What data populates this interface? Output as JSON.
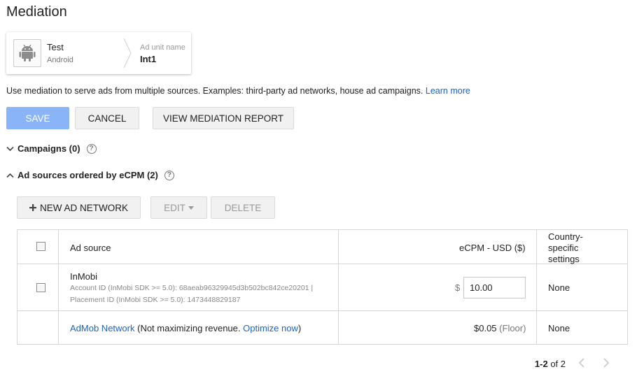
{
  "page": {
    "title": "Mediation"
  },
  "app_card": {
    "app_name": "Test",
    "platform": "Android",
    "ad_unit_label": "Ad unit name",
    "ad_unit_name": "Int1"
  },
  "description": {
    "text": "Use mediation to serve ads from multiple sources. Examples: third-party ad networks, house ad campaigns.",
    "learn_more": "Learn more"
  },
  "toolbar": {
    "save_label": "SAVE",
    "cancel_label": "CANCEL",
    "report_label": "VIEW MEDIATION REPORT"
  },
  "sections": {
    "campaigns": "Campaigns (0)",
    "ad_sources": "Ad sources ordered by eCPM (2)"
  },
  "table_toolbar": {
    "new_label": "NEW AD NETWORK",
    "edit_label": "EDIT",
    "delete_label": "DELETE"
  },
  "table": {
    "headers": {
      "ad_source": "Ad source",
      "ecpm": "eCPM - USD ($)",
      "country_line1": "Country-",
      "country_line2": "specific",
      "country_line3": "settings"
    },
    "rows": [
      {
        "name": "InMobi",
        "detail1": "Account ID (InMobi SDK >= 5.0): 68aeab96329945d3b502bc842ce20201 |",
        "detail2": "Placement ID (InMobi SDK >= 5.0): 1473448829187",
        "currency": "$",
        "ecpm_value": "10.00",
        "country": "None"
      },
      {
        "name": "AdMob Network",
        "note_prefix": "(Not maximizing revenue.",
        "optimize": "Optimize now",
        "note_suffix": ")",
        "ecpm_value": "$0.05",
        "ecpm_note": "(Floor)",
        "country": "None"
      }
    ]
  },
  "pagination": {
    "range": "1-2",
    "of_total": "of 2"
  },
  "colors": {
    "link": "#1a62c7",
    "save_button": "#8ab4f8"
  },
  "icons": [
    "android-icon",
    "help-icon",
    "chevron-down-icon",
    "chevron-up-icon",
    "plus-icon",
    "caret-down-icon",
    "chevron-left-icon",
    "chevron-right-icon"
  ]
}
